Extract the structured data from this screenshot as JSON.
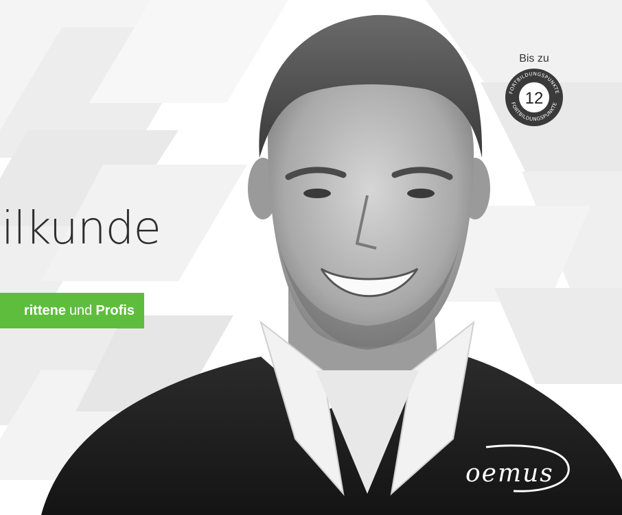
{
  "headline": {
    "text": "ilkunde"
  },
  "audience_tag": {
    "part1": "rittene",
    "connector": "und",
    "part2": "Profis",
    "color": "#5fbd3e"
  },
  "points_badge": {
    "label": "Bis zu",
    "number": "12",
    "ring_text": "FORTBILDUNGSPUNKTE"
  },
  "logo": {
    "text": "oemus"
  }
}
